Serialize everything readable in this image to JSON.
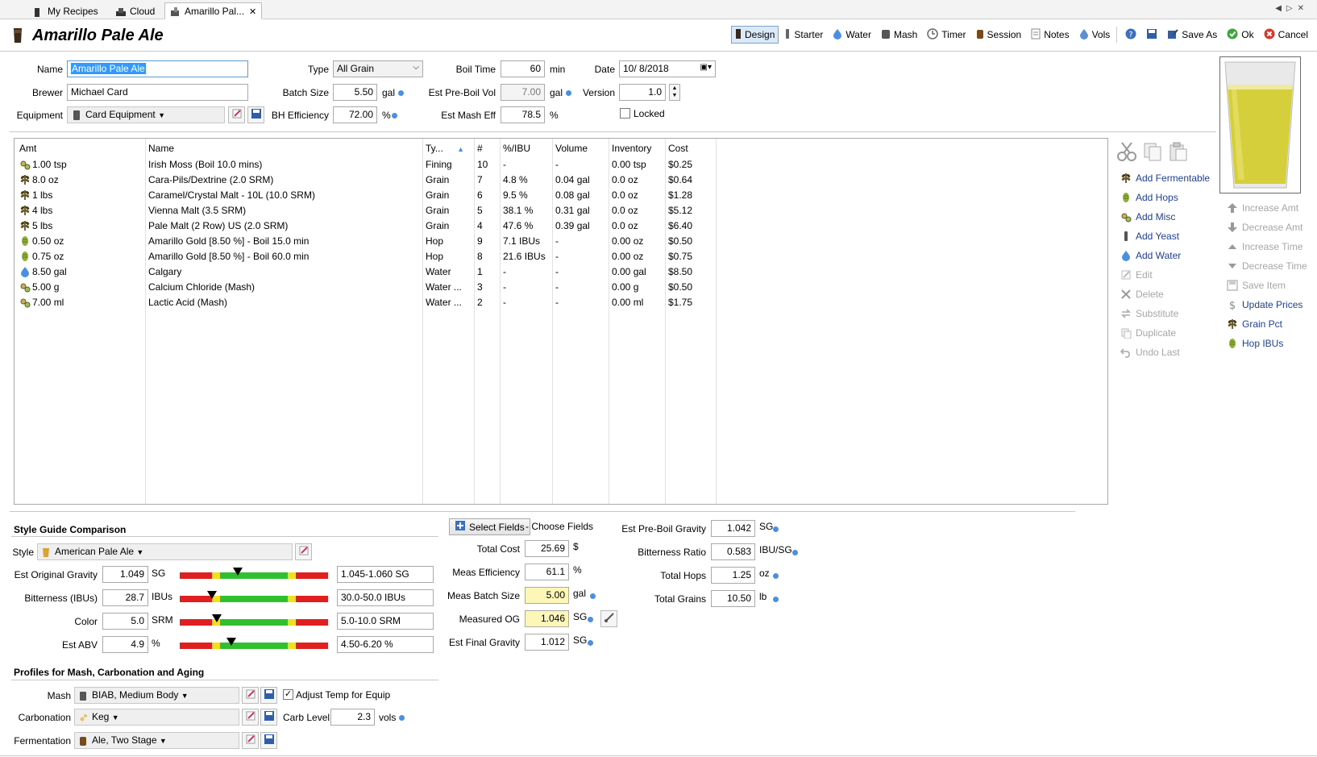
{
  "tabs": [
    {
      "label": "My Recipes"
    },
    {
      "label": "Cloud"
    },
    {
      "label": "Amarillo Pal..."
    }
  ],
  "title": "Amarillo Pale Ale",
  "toolbar": {
    "design": "Design",
    "starter": "Starter",
    "water": "Water",
    "mash": "Mash",
    "timer": "Timer",
    "session": "Session",
    "notes": "Notes",
    "vols": "Vols",
    "save_as": "Save As",
    "ok": "Ok",
    "cancel": "Cancel"
  },
  "form": {
    "name_label": "Name",
    "name_value": "Amarillo Pale Ale",
    "brewer_label": "Brewer",
    "brewer_value": "Michael Card",
    "equipment_label": "Equipment",
    "equipment_value": "Card Equipment",
    "type_label": "Type",
    "type_value": "All Grain",
    "batch_label": "Batch Size",
    "batch_value": "5.50",
    "batch_unit": "gal",
    "bh_label": "BH Efficiency",
    "bh_value": "72.00",
    "bh_unit": "%",
    "boil_label": "Boil Time",
    "boil_value": "60",
    "boil_unit": "min",
    "preboil_label": "Est Pre-Boil Vol",
    "preboil_value": "7.00",
    "preboil_unit": "gal",
    "masheff_label": "Est Mash Eff",
    "masheff_value": "78.5",
    "masheff_unit": "%",
    "date_label": "Date",
    "date_value": "10/ 8/2018",
    "version_label": "Version",
    "version_value": "1.0",
    "locked_label": "Locked"
  },
  "grid": {
    "headers": [
      "Amt",
      "Name",
      "Ty...",
      "#",
      "%/IBU",
      "Volume",
      "Inventory",
      "Cost"
    ],
    "rows": [
      {
        "amt": "1.00 tsp",
        "name": "Irish Moss (Boil 10.0 mins)",
        "type": "Fining",
        "num": "10",
        "pct": "-",
        "vol": "-",
        "inv": "0.00 tsp",
        "cost": "$0.25",
        "icon": "misc"
      },
      {
        "amt": "8.0 oz",
        "name": "Cara-Pils/Dextrine (2.0 SRM)",
        "type": "Grain",
        "num": "7",
        "pct": "4.8 %",
        "vol": "0.04 gal",
        "inv": "0.0 oz",
        "cost": "$0.64",
        "icon": "grain"
      },
      {
        "amt": "1 lbs",
        "name": "Caramel/Crystal Malt - 10L (10.0 SRM)",
        "type": "Grain",
        "num": "6",
        "pct": "9.5 %",
        "vol": "0.08 gal",
        "inv": "0.0 oz",
        "cost": "$1.28",
        "icon": "grain"
      },
      {
        "amt": "4 lbs",
        "name": "Vienna Malt (3.5 SRM)",
        "type": "Grain",
        "num": "5",
        "pct": "38.1 %",
        "vol": "0.31 gal",
        "inv": "0.0 oz",
        "cost": "$5.12",
        "icon": "grain"
      },
      {
        "amt": "5 lbs",
        "name": "Pale Malt (2 Row) US (2.0 SRM)",
        "type": "Grain",
        "num": "4",
        "pct": "47.6 %",
        "vol": "0.39 gal",
        "inv": "0.0 oz",
        "cost": "$6.40",
        "icon": "grain"
      },
      {
        "amt": "0.50 oz",
        "name": "Amarillo Gold [8.50 %] - Boil 15.0 min",
        "type": "Hop",
        "num": "9",
        "pct": "7.1 IBUs",
        "vol": "-",
        "inv": "0.00 oz",
        "cost": "$0.50",
        "icon": "hop"
      },
      {
        "amt": "0.75 oz",
        "name": "Amarillo Gold [8.50 %] - Boil 60.0 min",
        "type": "Hop",
        "num": "8",
        "pct": "21.6 IBUs",
        "vol": "-",
        "inv": "0.00 oz",
        "cost": "$0.75",
        "icon": "hop"
      },
      {
        "amt": "8.50 gal",
        "name": "Calgary",
        "type": "Water",
        "num": "1",
        "pct": "-",
        "vol": "-",
        "inv": "0.00 gal",
        "cost": "$8.50",
        "icon": "water"
      },
      {
        "amt": "5.00 g",
        "name": "Calcium Chloride (Mash)",
        "type": "Water ...",
        "num": "3",
        "pct": "-",
        "vol": "-",
        "inv": "0.00 g",
        "cost": "$0.50",
        "icon": "misc"
      },
      {
        "amt": "7.00 ml",
        "name": "Lactic Acid (Mash)",
        "type": "Water ...",
        "num": "2",
        "pct": "-",
        "vol": "-",
        "inv": "0.00 ml",
        "cost": "$1.75",
        "icon": "misc"
      }
    ]
  },
  "actions_left": [
    {
      "label": "Add Fermentable",
      "icon": "grain-icon",
      "enabled": true
    },
    {
      "label": "Add Hops",
      "icon": "hop-icon",
      "enabled": true
    },
    {
      "label": "Add Misc",
      "icon": "misc-icon",
      "enabled": true
    },
    {
      "label": "Add Yeast",
      "icon": "yeast-icon",
      "enabled": true
    },
    {
      "label": "Add Water",
      "icon": "water-drop-icon",
      "enabled": true
    },
    {
      "label": "Edit",
      "icon": "edit-icon",
      "enabled": false
    },
    {
      "label": "Delete",
      "icon": "delete-icon",
      "enabled": false
    },
    {
      "label": "Substitute",
      "icon": "substitute-icon",
      "enabled": false
    },
    {
      "label": "Duplicate",
      "icon": "duplicate-icon",
      "enabled": false
    },
    {
      "label": "Undo Last",
      "icon": "undo-icon",
      "enabled": false
    }
  ],
  "actions_right": [
    {
      "label": "Increase Amt",
      "icon": "arrow-up-icon",
      "enabled": false
    },
    {
      "label": "Decrease Amt",
      "icon": "arrow-down-icon",
      "enabled": false
    },
    {
      "label": "Increase Time",
      "icon": "triangle-up-icon",
      "enabled": false
    },
    {
      "label": "Decrease Time",
      "icon": "triangle-down-icon",
      "enabled": false
    },
    {
      "label": "Save Item",
      "icon": "save-icon",
      "enabled": false
    },
    {
      "label": "Update Prices",
      "icon": "dollar-icon",
      "enabled": true
    },
    {
      "label": "Grain Pct",
      "icon": "grain-icon",
      "enabled": true
    },
    {
      "label": "Hop IBUs",
      "icon": "hop-icon",
      "enabled": true
    }
  ],
  "style_guide": {
    "section_title": "Style Guide Comparison",
    "style_label": "Style",
    "style_value": "American Pale Ale",
    "rows": [
      {
        "label": "Est Original Gravity",
        "value": "1.049",
        "unit": "SG",
        "range": "1.045-1.060 SG",
        "marker": 0.39
      },
      {
        "label": "Bitterness (IBUs)",
        "value": "28.7",
        "unit": "IBUs",
        "range": "30.0-50.0 IBUs",
        "marker": 0.22
      },
      {
        "label": "Color",
        "value": "5.0",
        "unit": "SRM",
        "range": "5.0-10.0 SRM",
        "marker": 0.25
      },
      {
        "label": "Est ABV",
        "value": "4.9",
        "unit": "%",
        "range": "4.50-6.20 %",
        "marker": 0.35
      }
    ]
  },
  "profiles": {
    "section_title": "Profiles for Mash, Carbonation and Aging",
    "mash_label": "Mash",
    "mash_value": "BIAB, Medium Body",
    "adjust_label": "Adjust Temp for Equip",
    "carb_label": "Carbonation",
    "carb_value": "Keg",
    "carblevel_label": "Carb Level",
    "carblevel_value": "2.3",
    "carblevel_unit": "vols",
    "ferm_label": "Fermentation",
    "ferm_value": "Ale, Two Stage"
  },
  "measures": {
    "select_fields": "Select Fields",
    "choose_fields": "- Choose Fields",
    "rows": [
      {
        "label": "Total Cost",
        "value": "25.69",
        "unit": "$",
        "yellow": false,
        "dot": false
      },
      {
        "label": "Meas Efficiency",
        "value": "61.1",
        "unit": "%",
        "yellow": false,
        "dot": false
      },
      {
        "label": "Meas Batch Size",
        "value": "5.00",
        "unit": "gal",
        "yellow": true,
        "dot": true
      },
      {
        "label": "Measured OG",
        "value": "1.046",
        "unit": "SG",
        "yellow": true,
        "dot": true
      },
      {
        "label": "Est Final Gravity",
        "value": "1.012",
        "unit": "SG",
        "yellow": false,
        "dot": true
      }
    ]
  },
  "stats": [
    {
      "label": "Est Pre-Boil Gravity",
      "value": "1.042",
      "unit": "SG"
    },
    {
      "label": "Bitterness Ratio",
      "value": "0.583",
      "unit": "IBU/SG"
    },
    {
      "label": "Total Hops",
      "value": "1.25",
      "unit": "oz"
    },
    {
      "label": "Total Grains",
      "value": "10.50",
      "unit": "lb"
    }
  ],
  "colors": {
    "accent": "#4a90e2",
    "selection": "#3399ff",
    "yellow_field": "#fcf7b6",
    "beer": "#d6cf3c"
  }
}
